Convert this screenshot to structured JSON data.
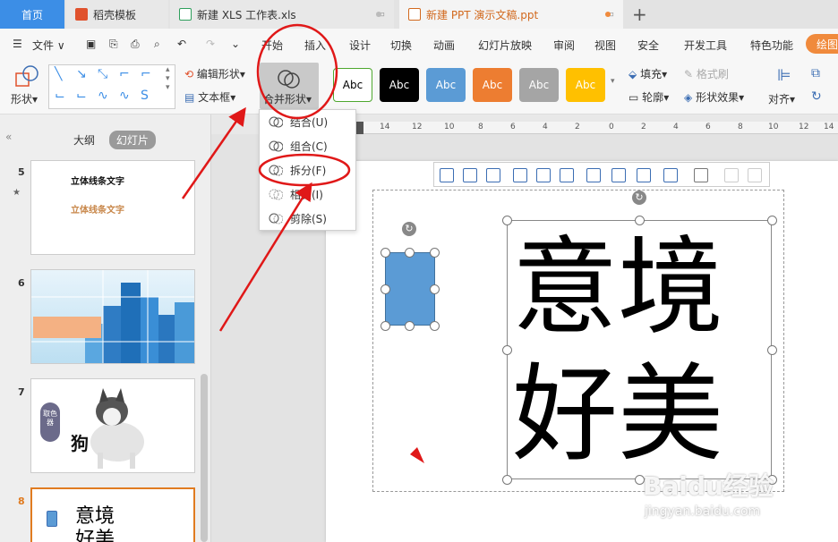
{
  "tabs": {
    "home": "首页",
    "templates": "稻壳模板",
    "xls": "新建 XLS 工作表.xls",
    "ppt": "新建 PPT 演示文稿.ppt",
    "add": "+"
  },
  "menu": {
    "file": "文件",
    "items": [
      "开始",
      "插入",
      "设计",
      "切换",
      "动画",
      "幻灯片放映",
      "审阅",
      "视图",
      "安全",
      "开发工具",
      "特色功能"
    ],
    "draw_tool": "绘图"
  },
  "ribbon": {
    "shape": "形状",
    "edit_shape": "编辑形状",
    "text_box": "文本框",
    "merge_shape": "合并形状",
    "style_label": "Abc",
    "fill": "填充",
    "format_brush": "格式刷",
    "outline": "轮廓",
    "shape_effect": "形状效果",
    "align": "对齐",
    "colors": {
      "white": "#ffffff",
      "black": "#000000",
      "blue": "#5b9bd5",
      "orange": "#ed7d31",
      "gray": "#a5a5a5",
      "gold": "#ffc000"
    }
  },
  "dropdown": {
    "items": [
      {
        "label": "结合(U)",
        "disabled": false
      },
      {
        "label": "组合(C)",
        "disabled": false
      },
      {
        "label": "拆分(F)",
        "disabled": false
      },
      {
        "label": "相交(I)",
        "disabled": false
      },
      {
        "label": "剪除(S)",
        "disabled": false
      }
    ]
  },
  "left_pane": {
    "outline_tab": "大纲",
    "slides_tab": "幻灯片",
    "slides": [
      {
        "num": "5",
        "title": "立体线条文字",
        "subtitle": "立体线条文字"
      },
      {
        "num": "6"
      },
      {
        "num": "7",
        "badge": "取色器",
        "caption": "狗"
      },
      {
        "num": "8",
        "text_line1": "意境",
        "text_line2": "好美"
      }
    ]
  },
  "ruler": {
    "labels": [
      "14",
      "12",
      "10",
      "8",
      "6",
      "4",
      "2",
      "0",
      "2",
      "4",
      "6",
      "8",
      "10",
      "12",
      "14"
    ]
  },
  "slide": {
    "line1": "意境",
    "line2": "好美"
  },
  "watermark": {
    "brand": "Baidu经验",
    "url": "jingyan.baidu.com"
  }
}
